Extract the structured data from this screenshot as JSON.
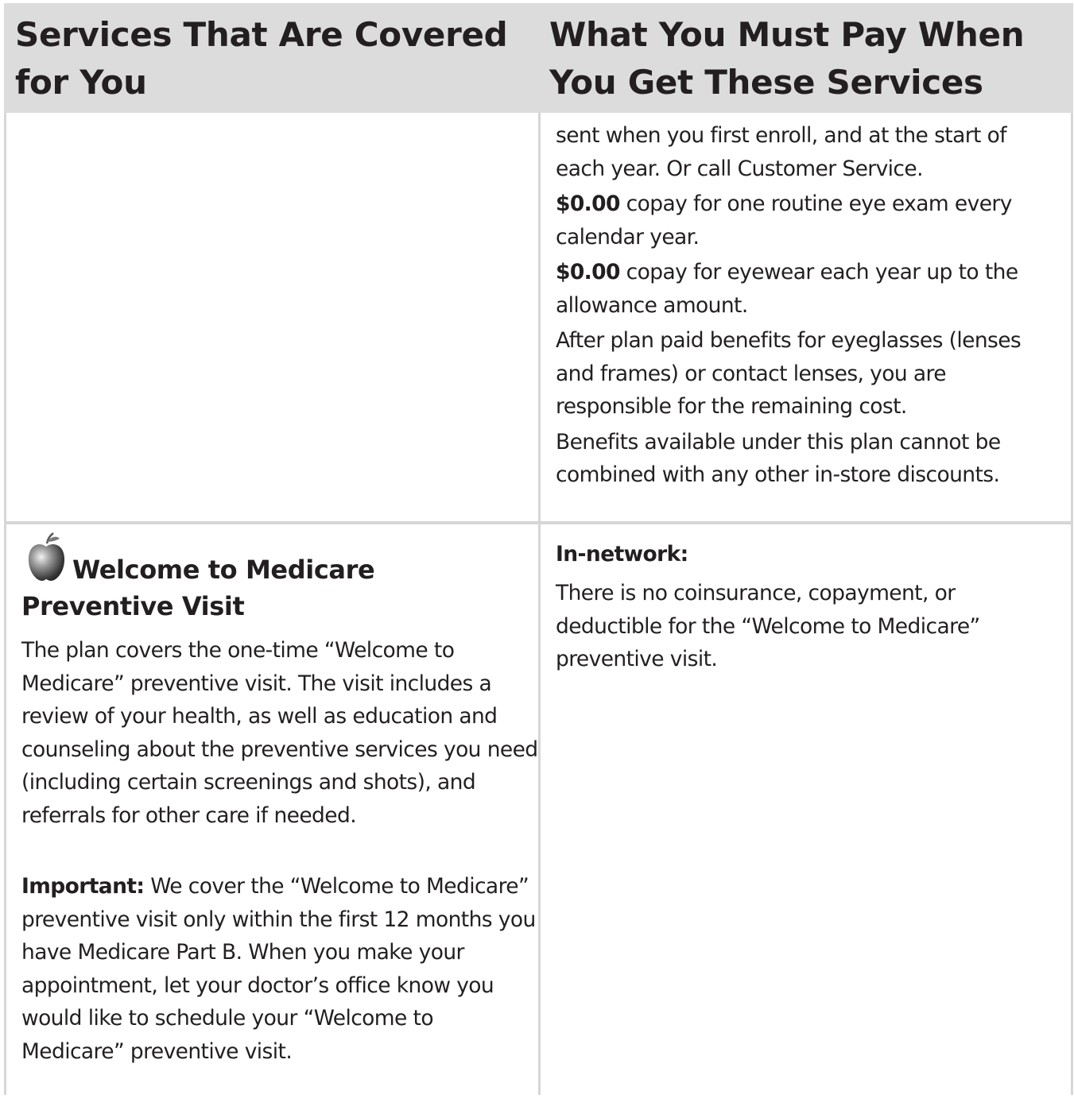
{
  "header": {
    "col1": "Services That Are Covered for You",
    "col2": "What You Must Pay When You Get These Services"
  },
  "row1": {
    "continuation": "sent when you first enroll, and at the start of each year. Or call Customer Service.",
    "eye_exam_amount": "$0.00",
    "eye_exam_text": " copay for one routine eye exam every calendar year.",
    "eyewear_amount": "$0.00",
    "eyewear_text": " copay for eyewear each year up to the allowance amount.",
    "after_benefits": "After plan paid benefits for eyeglasses (lenses and frames) or contact lenses, you are responsible for the remaining cost.",
    "discounts": "Benefits available under this plan cannot be combined with any other in-store discounts."
  },
  "row2": {
    "icon": "apple-icon",
    "service_title": "Welcome to Medicare Preventive Visit",
    "description": "The plan covers the one-time “Welcome to Medicare” preventive visit. The visit includes a review of your health, as well as education and counseling about the preventive services you need (including certain screenings and shots), and referrals for other care if needed.",
    "important_label": "Important:",
    "important_text": " We cover the “Welcome to Medicare” preventive visit only within the first 12 months you have Medicare Part B. When you make your appointment, let your doctor’s office know you would like to schedule your “Welcome to Medicare” preventive visit.",
    "network_label": "In-network:",
    "network_text": "There is no coinsurance, copayment, or deductible for the “Welcome to Medicare” preventive visit."
  }
}
